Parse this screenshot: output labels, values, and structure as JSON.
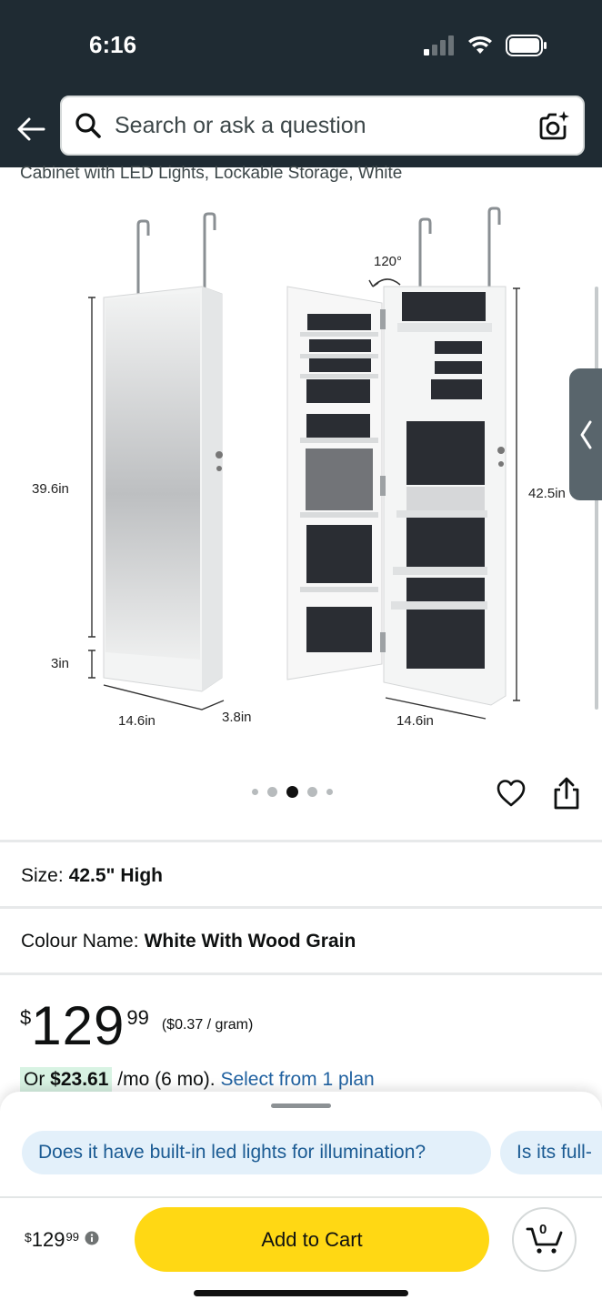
{
  "status_bar": {
    "time": "6:16"
  },
  "header": {
    "search_placeholder": "Search or ask a question",
    "back_icon": "arrow-left-icon",
    "camera_icon": "camera-sparkle-icon"
  },
  "product": {
    "title_fragment": "Cabinet with LED Lights, Lockable Storage, White",
    "image_labels": {
      "height_body": "39.6in",
      "height_base": "3in",
      "width_front": "14.6in",
      "depth": "3.8in",
      "angle": "120°",
      "height_total": "42.5in",
      "width_back": "14.6in"
    },
    "carousel": {
      "count": 5,
      "active_index": 2
    }
  },
  "options": {
    "size_label": "Size:",
    "size_value": "42.5\" High",
    "colour_label": "Colour Name:",
    "colour_value": "White With Wood Grain"
  },
  "price": {
    "symbol": "$",
    "whole": "129",
    "fraction": "99",
    "unit_price": "($0.37 / gram)"
  },
  "installment": {
    "prefix": "Or",
    "amount": "$23.61",
    "term": "/mo (6 mo).",
    "link": "Select from 1 plan"
  },
  "questions": [
    "Does it have built-in led lights for illumination?",
    "Is its full-"
  ],
  "bottom_bar": {
    "price_symbol": "$",
    "price_whole": "129",
    "price_fraction": "99",
    "add_to_cart": "Add to Cart",
    "cart_count": "0"
  },
  "colors": {
    "header_bg": "#1f2b33",
    "add_to_cart_bg": "#ffd814",
    "link": "#2162a1",
    "chip_bg": "#e3f0fa",
    "installment_highlight": "#d8f3e3"
  }
}
